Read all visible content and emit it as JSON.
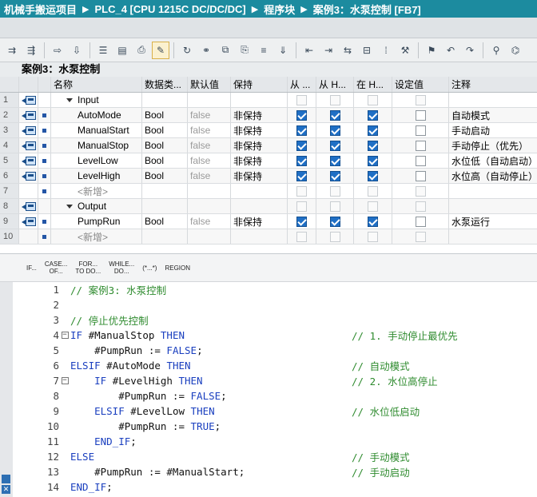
{
  "breadcrumb": [
    "机械手搬运项目",
    "PLC_4 [CPU 1215C DC/DC/DC]",
    "程序块",
    "案例3：水泵控制 [FB7]"
  ],
  "block_title": "案例3：水泵控制",
  "columns": [
    "名称",
    "数据类...",
    "默认值",
    "保持",
    "从 ...",
    "从 H...",
    "在 H...",
    "设定值",
    "注释"
  ],
  "rows": [
    {
      "num": "1",
      "kind": "section",
      "name": "Input"
    },
    {
      "num": "2",
      "kind": "var",
      "name": "AutoMode",
      "type": "Bool",
      "default": "false",
      "retain": "非保持",
      "c1": true,
      "c2": true,
      "c3": true,
      "comment": "自动模式"
    },
    {
      "num": "3",
      "kind": "var",
      "name": "ManualStart",
      "type": "Bool",
      "default": "false",
      "retain": "非保持",
      "c1": true,
      "c2": true,
      "c3": true,
      "comment": "手动启动"
    },
    {
      "num": "4",
      "kind": "var",
      "name": "ManualStop",
      "type": "Bool",
      "default": "false",
      "retain": "非保持",
      "c1": true,
      "c2": true,
      "c3": true,
      "comment": "手动停止（优先）"
    },
    {
      "num": "5",
      "kind": "var",
      "name": "LevelLow",
      "type": "Bool",
      "default": "false",
      "retain": "非保持",
      "c1": true,
      "c2": true,
      "c3": true,
      "comment": "水位低（自动启动）"
    },
    {
      "num": "6",
      "kind": "var",
      "name": "LevelHigh",
      "type": "Bool",
      "default": "false",
      "retain": "非保持",
      "c1": true,
      "c2": true,
      "c3": true,
      "comment": "水位高（自动停止）"
    },
    {
      "num": "7",
      "kind": "new",
      "name": "<新增>"
    },
    {
      "num": "8",
      "kind": "section",
      "name": "Output"
    },
    {
      "num": "9",
      "kind": "var",
      "name": "PumpRun",
      "type": "Bool",
      "default": "false",
      "retain": "非保持",
      "c1": true,
      "c2": true,
      "c3": true,
      "comment": "水泵运行"
    },
    {
      "num": "10",
      "kind": "new",
      "name": "<新增>"
    }
  ],
  "keywords": [
    {
      "l1": "IF...",
      "l2": ""
    },
    {
      "l1": "CASE...",
      "l2": "OF..."
    },
    {
      "l1": "FOR...",
      "l2": "TO DO..."
    },
    {
      "l1": "WHILE...",
      "l2": "DO..."
    },
    {
      "l1": "(*...*)",
      "l2": ""
    },
    {
      "l1": "REGION",
      "l2": ""
    }
  ],
  "code": [
    {
      "n": "1",
      "fold": "",
      "parts": [
        [
          "g",
          "// 案例3: 水泵控制"
        ]
      ],
      "comment": ""
    },
    {
      "n": "2",
      "fold": "",
      "parts": [],
      "comment": ""
    },
    {
      "n": "3",
      "fold": "",
      "parts": [
        [
          "g",
          "// 停止优先控制"
        ]
      ],
      "comment": ""
    },
    {
      "n": "4",
      "fold": "box",
      "parts": [
        [
          "k",
          "IF"
        ],
        [
          "ink",
          " #ManualStop "
        ],
        [
          "k",
          "THEN"
        ]
      ],
      "comment": "// 1. 手动停止最优先"
    },
    {
      "n": "5",
      "fold": "",
      "parts": [
        [
          "ink",
          "    #PumpRun := "
        ],
        [
          "k",
          "FALSE"
        ],
        [
          "ink",
          ";"
        ]
      ],
      "comment": ""
    },
    {
      "n": "6",
      "fold": "",
      "parts": [
        [
          "k",
          "ELSIF"
        ],
        [
          "ink",
          " #AutoMode "
        ],
        [
          "k",
          "THEN"
        ]
      ],
      "comment": "// 自动模式"
    },
    {
      "n": "7",
      "fold": "box",
      "parts": [
        [
          "ink",
          "    "
        ],
        [
          "k",
          "IF"
        ],
        [
          "ink",
          " #LevelHigh "
        ],
        [
          "k",
          "THEN"
        ]
      ],
      "comment": "// 2. 水位高停止"
    },
    {
      "n": "8",
      "fold": "",
      "parts": [
        [
          "ink",
          "        #PumpRun := "
        ],
        [
          "k",
          "FALSE"
        ],
        [
          "ink",
          ";"
        ]
      ],
      "comment": ""
    },
    {
      "n": "9",
      "fold": "",
      "parts": [
        [
          "ink",
          "    "
        ],
        [
          "k",
          "ELSIF"
        ],
        [
          "ink",
          " #LevelLow "
        ],
        [
          "k",
          "THEN"
        ]
      ],
      "comment": "// 水位低启动"
    },
    {
      "n": "10",
      "fold": "",
      "parts": [
        [
          "ink",
          "        #PumpRun := "
        ],
        [
          "k",
          "TRUE"
        ],
        [
          "ink",
          ";"
        ]
      ],
      "comment": ""
    },
    {
      "n": "11",
      "fold": "",
      "parts": [
        [
          "ink",
          "    "
        ],
        [
          "k",
          "END_IF"
        ],
        [
          "ink",
          ";"
        ]
      ],
      "comment": ""
    },
    {
      "n": "12",
      "fold": "",
      "parts": [
        [
          "k",
          "ELSE"
        ]
      ],
      "comment": "// 手动模式"
    },
    {
      "n": "13",
      "fold": "",
      "parts": [
        [
          "ink",
          "    #PumpRun := #ManualStart;"
        ]
      ],
      "comment": "// 手动启动"
    },
    {
      "n": "14",
      "fold": "",
      "parts": [
        [
          "k",
          "END_IF"
        ],
        [
          "ink",
          ";"
        ]
      ],
      "comment": ""
    }
  ]
}
